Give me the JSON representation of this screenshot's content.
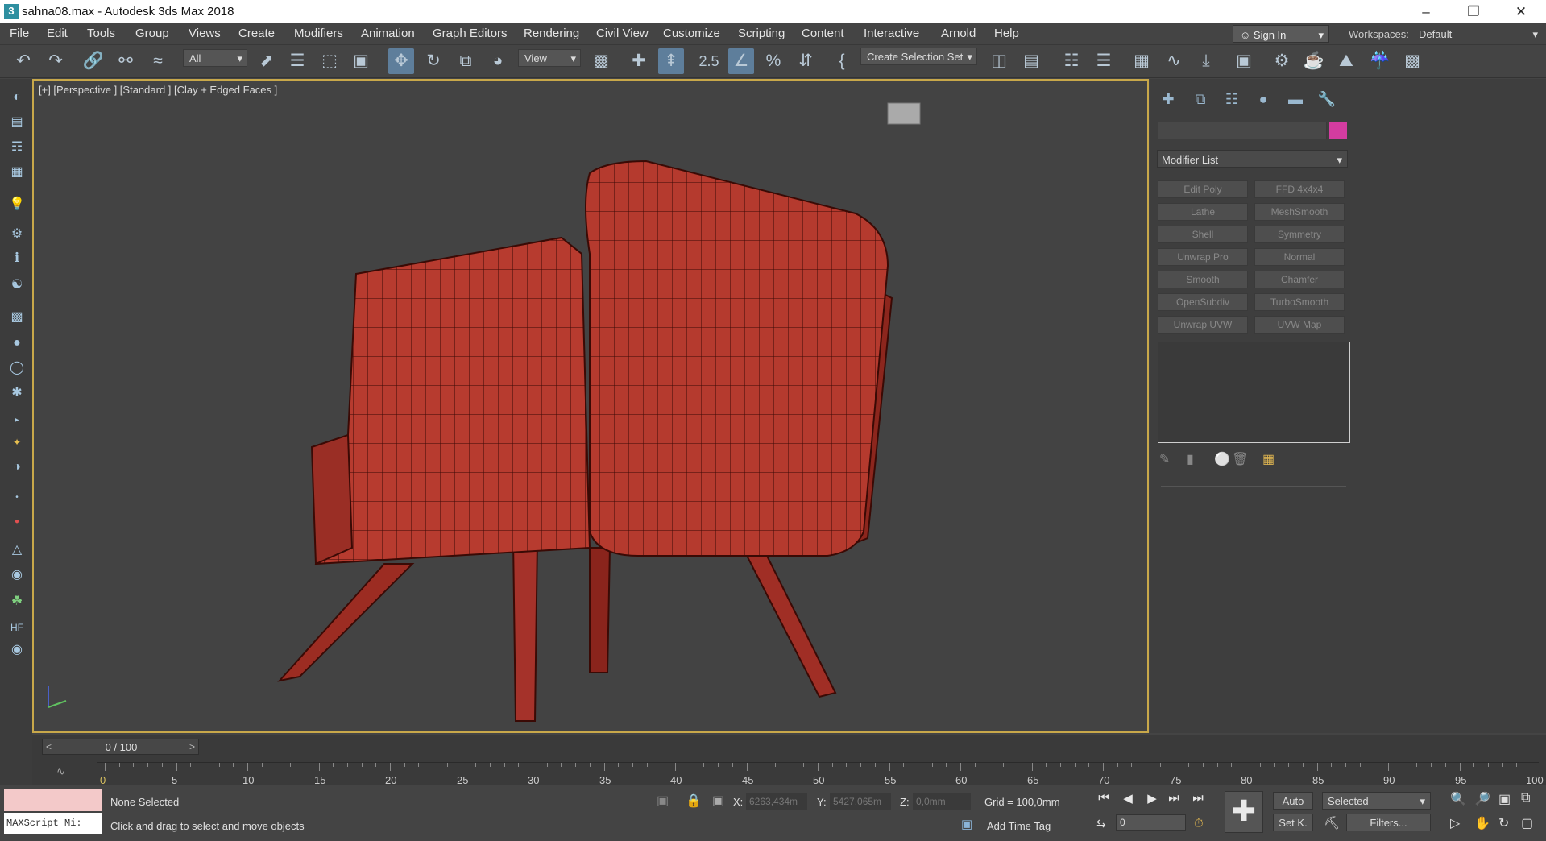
{
  "window": {
    "title": "sahna08.max - Autodesk 3ds Max 2018",
    "app_icon": "3"
  },
  "menu": [
    "File",
    "Edit",
    "Tools",
    "Group",
    "Views",
    "Create",
    "Modifiers",
    "Animation",
    "Graph Editors",
    "Rendering",
    "Civil View",
    "Customize",
    "Scripting",
    "Content",
    "Interactive",
    "Arnold",
    "Help"
  ],
  "signin": {
    "label": "Sign In"
  },
  "workspace": {
    "label": "Workspaces:",
    "value": "Default"
  },
  "toolbar": {
    "filter": "All",
    "refcoord": "View",
    "selection_set": "Create Selection Set",
    "snap_angle": "2.5"
  },
  "viewport": {
    "label": "[+] [Perspective ] [Standard ] [Clay + Edged Faces ]"
  },
  "modifiers": {
    "list_label": "Modifier List",
    "buttons": [
      "Edit Poly",
      "FFD 4x4x4",
      "Lathe",
      "MeshSmooth",
      "Shell",
      "Symmetry",
      "Unwrap Pro",
      "Normal",
      "Smooth",
      "Chamfer",
      "OpenSubdiv",
      "TurboSmooth",
      "Unwrap UVW",
      "UVW Map"
    ]
  },
  "object_color": "#d43ca0",
  "timeline": {
    "frame": "0 / 100",
    "ticks": [
      0,
      5,
      10,
      15,
      20,
      25,
      30,
      35,
      40,
      45,
      50,
      55,
      60,
      65,
      70,
      75,
      80,
      85,
      90,
      95,
      100
    ]
  },
  "status": {
    "selection": "None Selected",
    "prompt": "Click and drag to select and move objects",
    "maxscript": "MAXScript Mi:",
    "x_label": "X:",
    "x_value": "6263,434m",
    "y_label": "Y:",
    "y_value": "5427,065m",
    "z_label": "Z:",
    "z_value": "0,0mm",
    "grid": "Grid = 100,0mm",
    "add_time_tag": "Add Time Tag",
    "auto": "Auto",
    "key_mode": "Selected",
    "set_key": "Set K.",
    "filters": "Filters...",
    "frame_input": "0"
  }
}
